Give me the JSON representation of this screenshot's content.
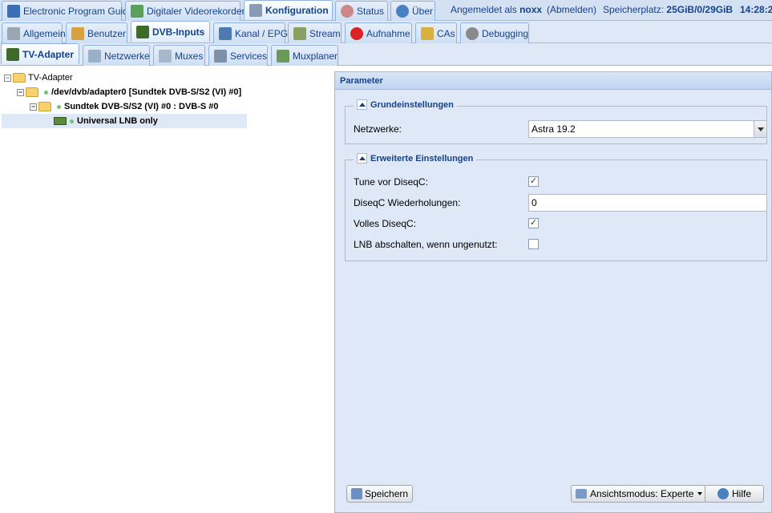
{
  "top_tabs": [
    {
      "label": "Electronic Program Guide",
      "icon": "epg-icon"
    },
    {
      "label": "Digitaler Videorekorder",
      "icon": "download-icon"
    },
    {
      "label": "Konfiguration",
      "icon": "wrench-icon",
      "active": true
    },
    {
      "label": "Status",
      "icon": "eye-icon"
    },
    {
      "label": "Über",
      "icon": "info-icon"
    }
  ],
  "status": {
    "logged_in_prefix": "Angemeldet als",
    "user": "noxx",
    "logout": "(Abmelden)",
    "storage_label": "Speicherplatz:",
    "storage_value": "25GiB/0/29GiB",
    "time": "14:28:2"
  },
  "config_tabs": [
    {
      "label": "Allgemein",
      "icon": "tools-icon"
    },
    {
      "label": "Benutzer",
      "icon": "user-icon"
    },
    {
      "label": "DVB-Inputs",
      "icon": "dvb-card-icon",
      "active": true
    },
    {
      "label": "Kanal / EPG",
      "icon": "tv-icon"
    },
    {
      "label": "Stream",
      "icon": "stream-icon"
    },
    {
      "label": "Aufnahme",
      "icon": "rec-icon"
    },
    {
      "label": "CAs",
      "icon": "key-icon"
    },
    {
      "label": "Debugging",
      "icon": "bug-icon"
    }
  ],
  "dvb_tabs": [
    {
      "label": "TV-Adapter",
      "icon": "tv-adapter-icon",
      "active": true
    },
    {
      "label": "Netzwerke",
      "icon": "antenna-icon"
    },
    {
      "label": "Muxes",
      "icon": "mux-icon"
    },
    {
      "label": "Services",
      "icon": "services-icon"
    },
    {
      "label": "Muxplaner",
      "icon": "calendar-icon"
    }
  ],
  "tree": {
    "root": "TV-Adapter",
    "adapter": "/dev/dvb/adapter0 [Sundtek DVB-S/S2 (VI) #0]",
    "frontend": "Sundtek DVB-S/S2 (VI) #0 : DVB-S #0",
    "lnb": "Universal LNB only"
  },
  "panel": {
    "title": "Parameter",
    "basic": {
      "legend": "Grundeinstellungen",
      "network_label": "Netzwerke:",
      "network_value": "Astra 19.2"
    },
    "advanced": {
      "legend": "Erweiterte Einstellungen",
      "tune_label": "Tune vor DiseqC:",
      "tune_checked": true,
      "repeats_label": "DiseqC Wiederholungen:",
      "repeats_value": "0",
      "full_label": "Volles DiseqC:",
      "full_checked": true,
      "lnb_off_label": "LNB abschalten, wenn ungenutzt:",
      "lnb_off_checked": false
    },
    "save_label": "Speichern",
    "view_mode_label": "Ansichtsmodus: Experte",
    "help_label": "Hilfe"
  },
  "colors": {
    "accent": "#15428b",
    "tab_border": "#8db2e3",
    "panel_bg": "#dfe8f6"
  }
}
